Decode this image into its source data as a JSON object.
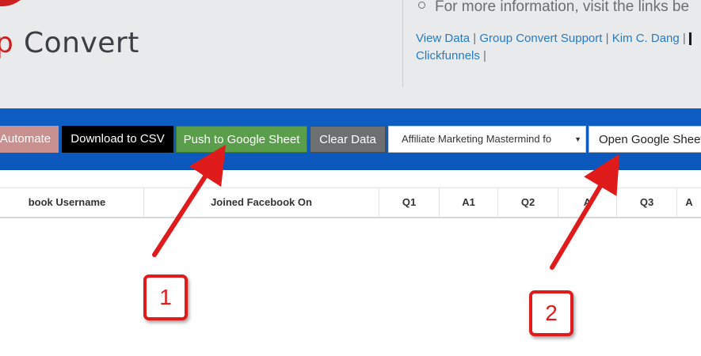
{
  "header": {
    "logo_letter": "p",
    "logo_word": "Convert",
    "info_text": "For more information, visit the links be",
    "links": [
      "View Data",
      "Group Convert Support",
      "Kim C. Dang",
      "Clickfunnels"
    ]
  },
  "toolbar": {
    "automate_label": "Automate",
    "csv_label": "Download to CSV",
    "push_label": "Push to Google Sheet",
    "clear_label": "Clear Data",
    "group_select_value": "Affiliate Marketing Mastermind fo",
    "open_sheet_label": "Open Google Sheet"
  },
  "table": {
    "columns": [
      "book Username",
      "Joined Facebook On",
      "Q1",
      "A1",
      "Q2",
      "A",
      "Q3",
      "A"
    ]
  },
  "annotations": {
    "callout_1": "1",
    "callout_2": "2",
    "color": "#e01b1b"
  },
  "colors": {
    "toolbar_blue": "#0e5fc4",
    "push_green": "#5a9e4c",
    "link_blue": "#2a7abf",
    "logo_red": "#cc1f1f"
  }
}
